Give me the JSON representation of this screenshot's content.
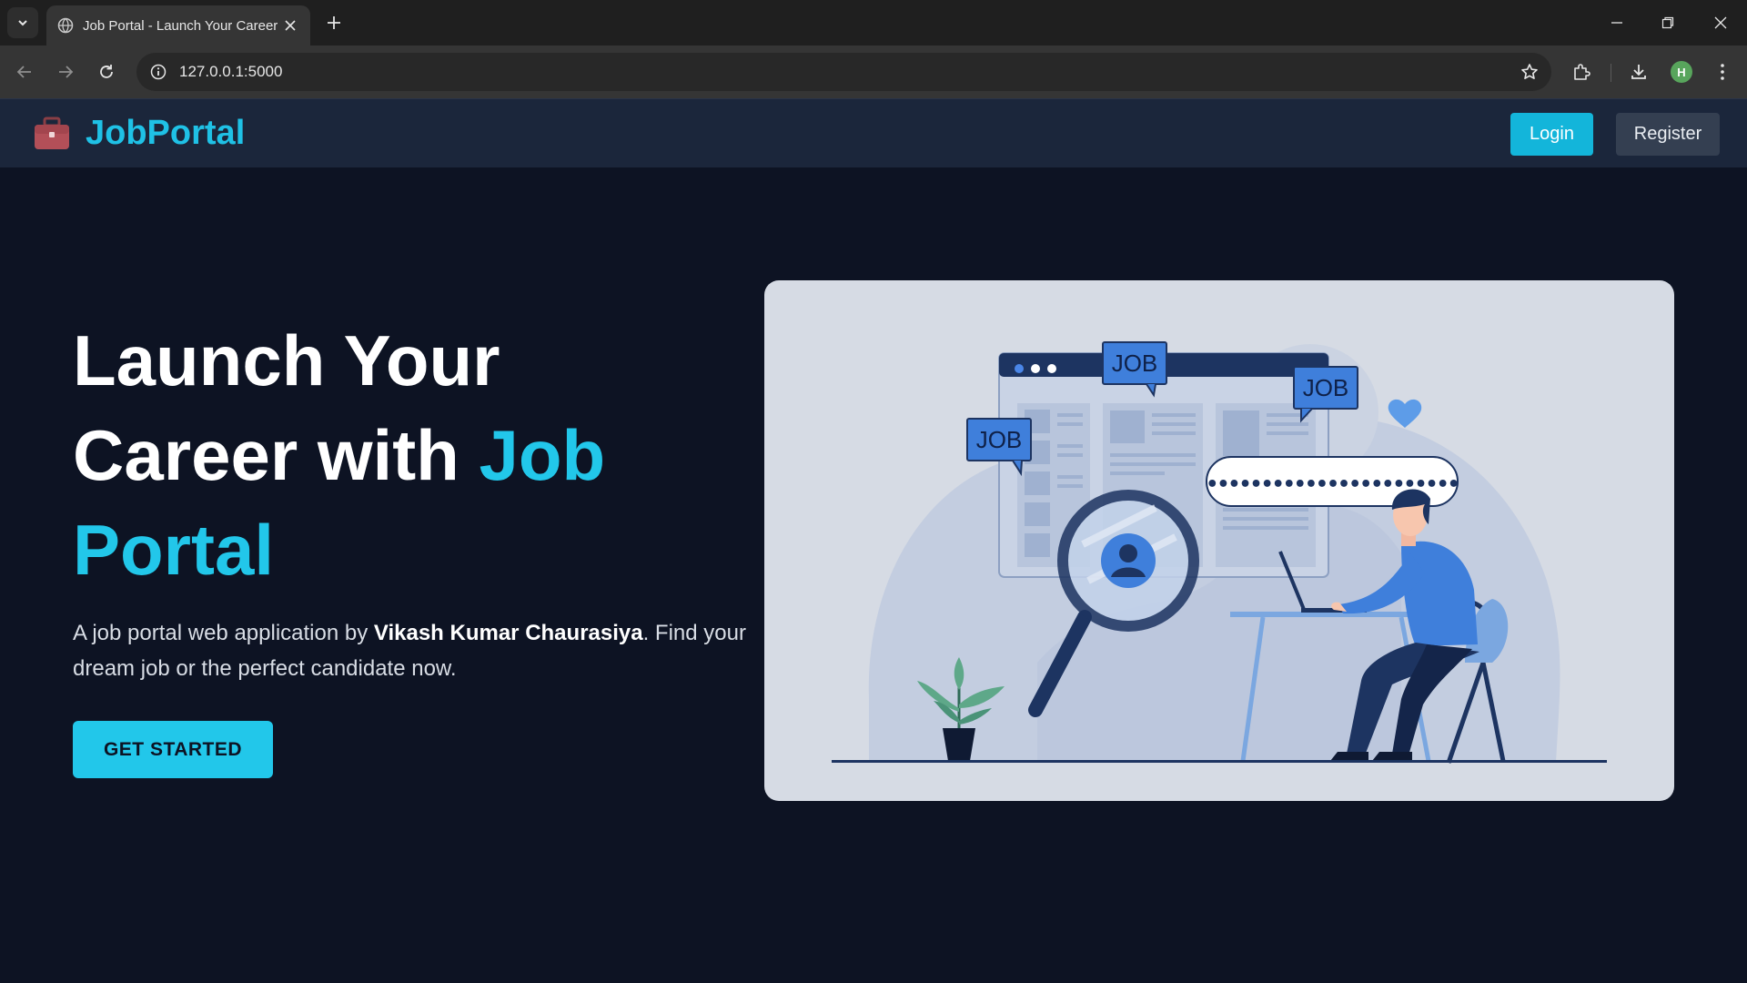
{
  "browser": {
    "tab_title": "Job Portal - Launch Your Career",
    "url": "127.0.0.1:5000",
    "profile_initial": "H"
  },
  "navbar": {
    "brand": "JobPortal",
    "login_label": "Login",
    "register_label": "Register"
  },
  "hero": {
    "title_line1": "Launch Your",
    "title_line2_plain": "Career with ",
    "title_line2_accent": "Job",
    "title_line3_accent": "Portal",
    "desc_prefix": "A job portal web application by ",
    "desc_author": "Vikash Kumar Chaurasiya",
    "desc_suffix": ". Find your dream job or the perfect candidate now.",
    "cta_label": "GET STARTED"
  },
  "illustration": {
    "bubble_labels": [
      "JOB",
      "JOB",
      "JOB"
    ],
    "password_mask": "•••••••••••••••••••••••"
  },
  "colors": {
    "page_bg": "#0d1323",
    "navbar_bg": "#1b263b",
    "accent": "#22c7ea",
    "login_bg": "#13b5da",
    "register_bg": "#343f51"
  }
}
